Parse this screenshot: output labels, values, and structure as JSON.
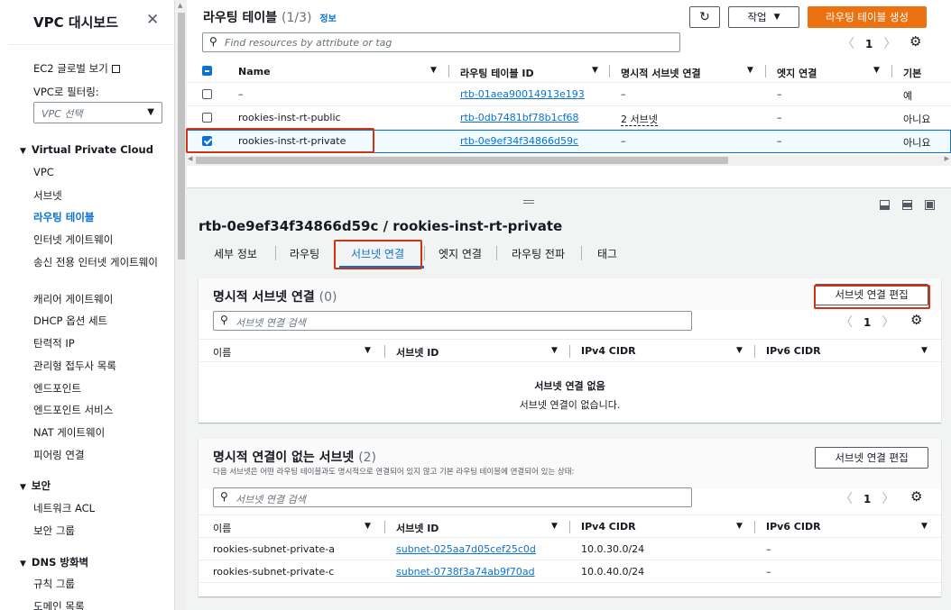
{
  "sidebar": {
    "title": "VPC 대시보드",
    "close_icon": "✕",
    "ec2_global": "EC2 글로벌 보기",
    "filter_label": "VPC로 필터링:",
    "vpc_select_placeholder": "VPC 선택",
    "section_vpc": "Virtual Private Cloud",
    "items_vpc": [
      "VPC",
      "서브넷",
      "라우팅 테이블",
      "인터넷 게이트웨이",
      "송신 전용 인터넷 게이트웨이",
      "캐리어 게이트웨이",
      "DHCP 옵션 세트",
      "탄력적 IP",
      "관리형 접두사 목록",
      "엔드포인트",
      "엔드포인트 서비스",
      "NAT 게이트웨이",
      "피어링 연결"
    ],
    "active_item": "라우팅 테이블",
    "section_security": "보안",
    "items_security": [
      "네트워크 ACL",
      "보안 그룹"
    ],
    "section_dns": "DNS 방화벽",
    "items_dns": [
      "규칙 그룹",
      "도메인 목록"
    ]
  },
  "route_tables": {
    "title": "라우팅 테이블",
    "count": "(1/3)",
    "info_link": "정보",
    "refresh_icon": "refresh-icon",
    "actions_button": "작업",
    "create_button": "라우팅 테이블 생성",
    "search_placeholder": "Find resources by attribute or tag",
    "page": "1",
    "columns": [
      "Name",
      "라우팅 테이블 ID",
      "명시적 서브넷 연결",
      "엣지 연결",
      "기본"
    ],
    "rows": [
      {
        "name": "–",
        "id": "rtb-01aea90014913e193",
        "explicit": "–",
        "edge": "–",
        "main": "예",
        "selected": false
      },
      {
        "name": "rookies-inst-rt-public",
        "id": "rtb-0db7481bf78b1cf68",
        "explicit": "2 서브넷",
        "edge": "–",
        "main": "아니요",
        "selected": false
      },
      {
        "name": "rookies-inst-rt-private",
        "id": "rtb-0e9ef34f34866d59c",
        "explicit": "–",
        "edge": "–",
        "main": "아니요",
        "selected": true
      }
    ]
  },
  "detail": {
    "title": "rtb-0e9ef34f34866d59c / rookies-inst-rt-private",
    "tabs": [
      "세부 정보",
      "라우팅",
      "서브넷 연결",
      "엣지 연결",
      "라우팅 전파",
      "태그"
    ],
    "active_tab": "서브넷 연결",
    "explicit": {
      "title": "명시적 서브넷 연결",
      "count": "(0)",
      "edit_button": "서브넷 연결 편집",
      "search_placeholder": "서브넷 연결 검색",
      "page": "1",
      "columns": [
        "이름",
        "서브넷 ID",
        "IPv4 CIDR",
        "IPv6 CIDR"
      ],
      "empty_title": "서브넷 연결 없음",
      "empty_desc": "서브넷 연결이 없습니다."
    },
    "non_explicit": {
      "title": "명시적 연결이 없는 서브넷",
      "count": "(2)",
      "description": "다음 서브넷은 어떤 라우팅 테이블과도 명시적으로 연결되어 있지 않고 기본 라우팅 테이블에 연결되어 있는 상태:",
      "edit_button": "서브넷 연결 편집",
      "search_placeholder": "서브넷 연결 검색",
      "page": "1",
      "columns": [
        "이름",
        "서브넷 ID",
        "IPv4 CIDR",
        "IPv6 CIDR"
      ],
      "rows": [
        {
          "name": "rookies-subnet-private-a",
          "id": "subnet-025aa7d05cef25c0d",
          "ipv4": "10.0.30.0/24",
          "ipv6": "–"
        },
        {
          "name": "rookies-subnet-private-c",
          "id": "subnet-0738f3a74ab9f70ad",
          "ipv4": "10.0.40.0/24",
          "ipv6": "–"
        }
      ]
    }
  },
  "colors": {
    "accent": "#0972d3",
    "primary_button": "#ec7211",
    "highlight": "#d13212"
  }
}
